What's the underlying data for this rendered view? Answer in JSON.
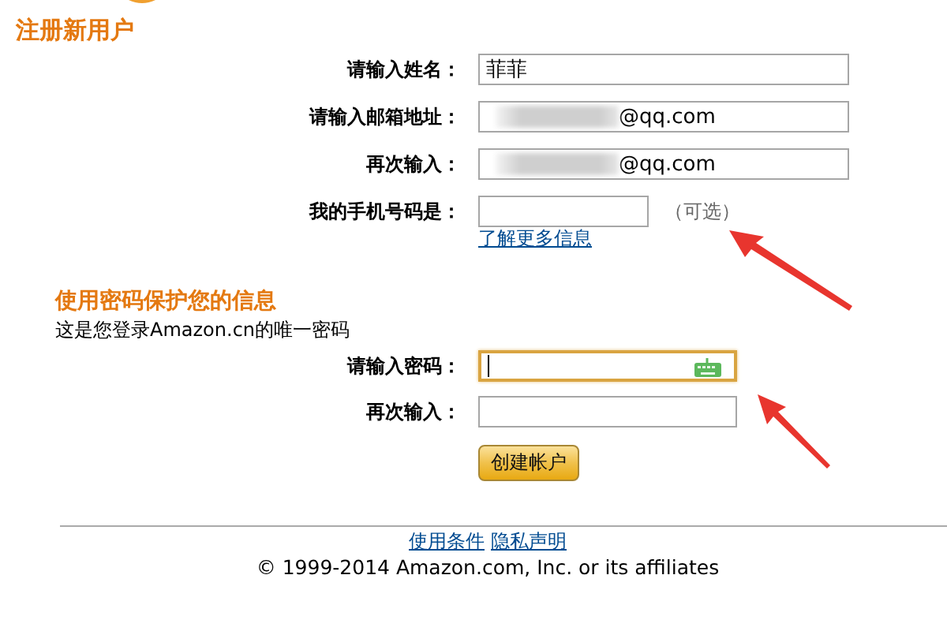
{
  "page_title": "注册新用户",
  "contact_fields": [
    {
      "label": "请输入姓名：",
      "value": "菲菲",
      "masked": false
    },
    {
      "label": "请输入邮箱地址：",
      "value": "@qq.com",
      "masked": true
    },
    {
      "label": "再次输入：",
      "value": "@qq.com",
      "masked": true
    }
  ],
  "phone": {
    "label": "我的手机号码是：",
    "note": "（可选）",
    "link": "了解更多信息"
  },
  "password_section": {
    "heading": "使用密码保护您的信息",
    "subtitle": "这是您登录Amazon.cn的唯一密码",
    "fields": [
      {
        "label": "请输入密码：",
        "kind": "password",
        "focused": true
      },
      {
        "label": "再次输入：",
        "kind": "text",
        "focused": false
      }
    ]
  },
  "create_button": "创建帐户",
  "footer": {
    "links": [
      "使用条件",
      "隐私声明"
    ],
    "copyright": "© 1999-2014 Amazon.com, Inc. or its affiliates"
  }
}
